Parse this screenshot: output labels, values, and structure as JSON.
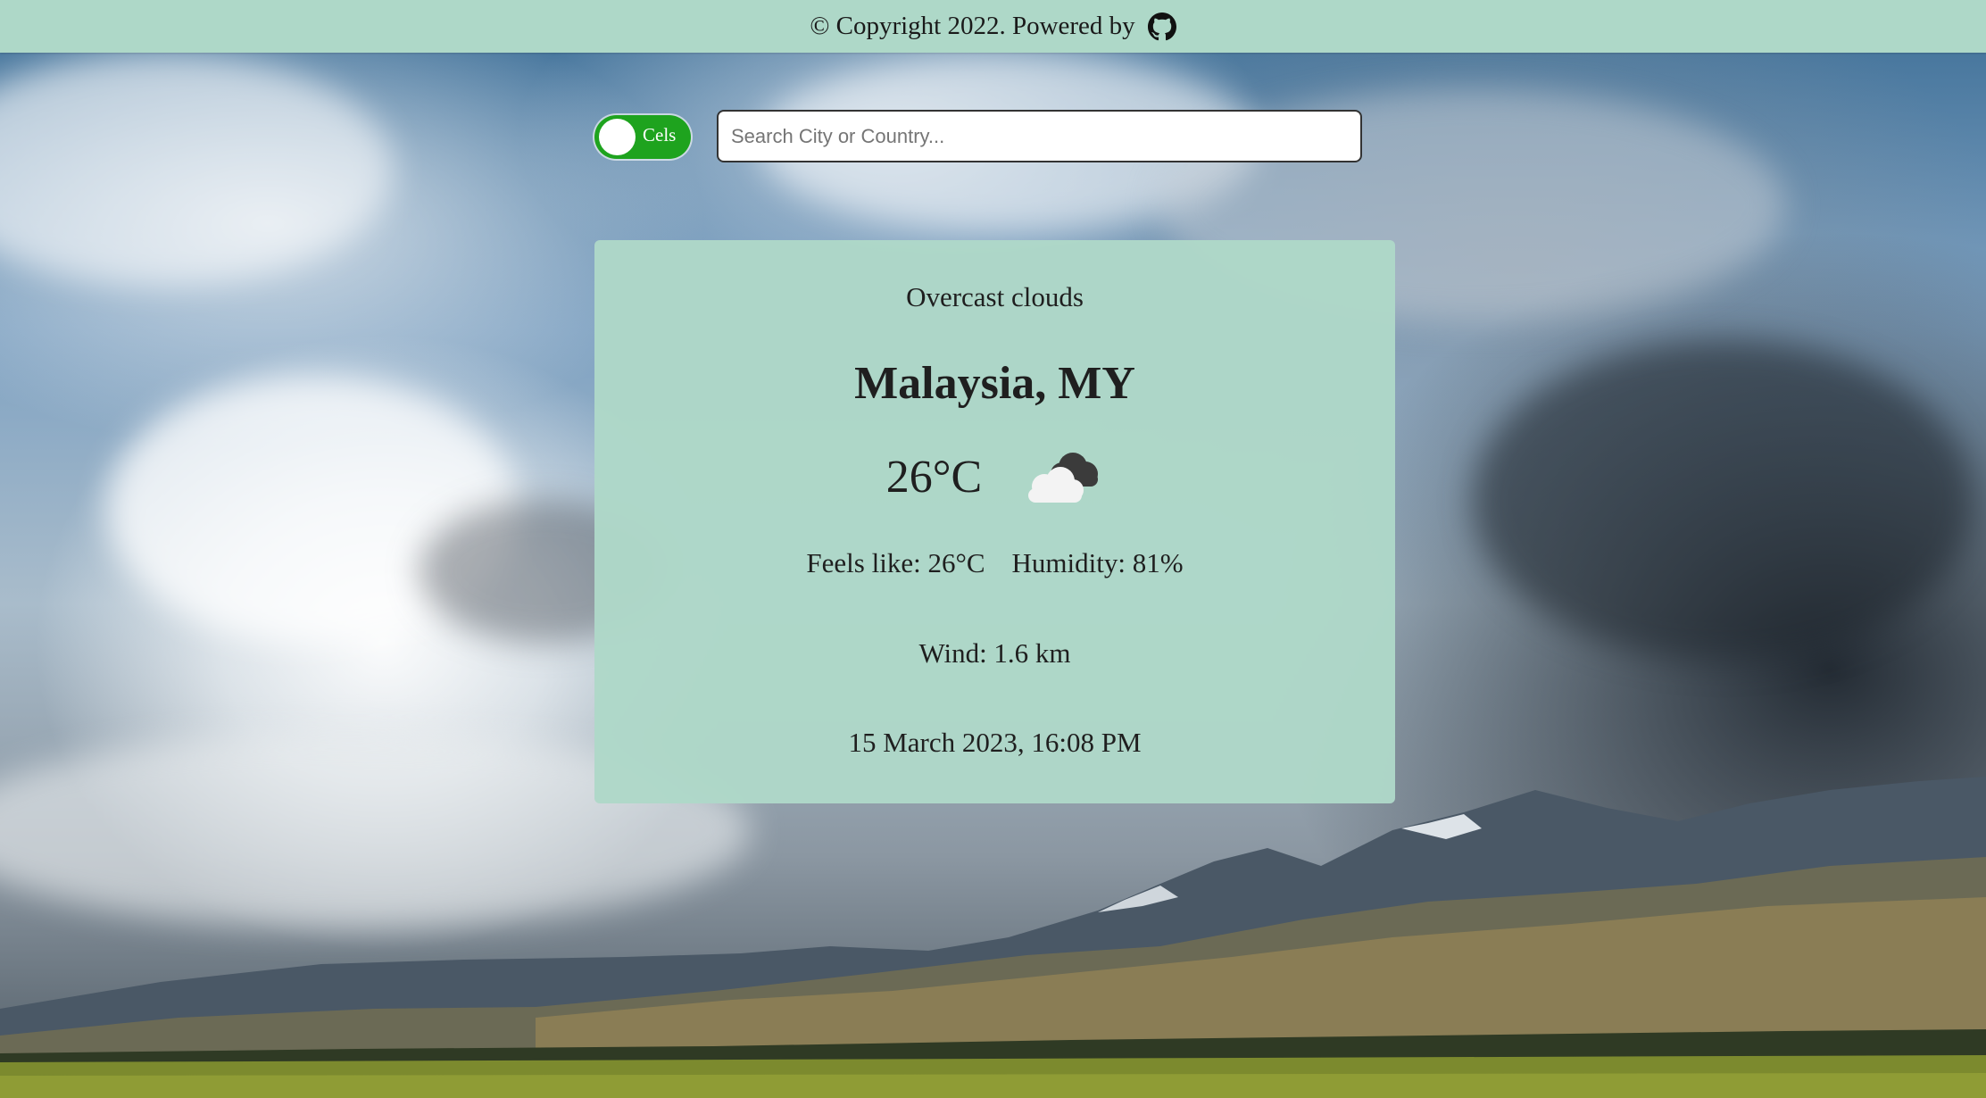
{
  "footer": {
    "copyright_text": "© Copyright 2022. Powered by",
    "icon": "github-icon"
  },
  "controls": {
    "unit_toggle_label": "Cels",
    "unit_toggle_on": true,
    "search_placeholder": "Search City or Country...",
    "search_value": ""
  },
  "weather": {
    "description": "Overcast clouds",
    "location": "Malaysia, MY",
    "temperature": "26°C",
    "icon": "overcast-clouds-icon",
    "feels_like": "Feels like: 26°C",
    "humidity": "Humidity: 81%",
    "wind": "Wind: 1.6 km",
    "datetime": "15 March 2023, 16:08 PM"
  },
  "colors": {
    "panel": "#aed8c8",
    "toggle_active": "#1ea31e"
  }
}
